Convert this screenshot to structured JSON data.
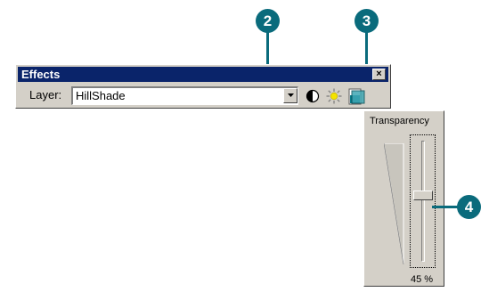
{
  "callouts": {
    "c2": "2",
    "c3": "3",
    "c4": "4"
  },
  "window": {
    "title": "Effects",
    "close_glyph": "×"
  },
  "layer": {
    "label": "Layer:",
    "selected": "HillShade"
  },
  "tools": [
    "contrast-icon",
    "brightness-icon",
    "transparency-icon"
  ],
  "transparency": {
    "title": "Transparency",
    "value_text": "45 %",
    "value": 45
  },
  "colors": {
    "callout": "#0a6b7c",
    "titlebar": "#0a246a",
    "face": "#d4d0c8",
    "sun": "#f4e300"
  }
}
